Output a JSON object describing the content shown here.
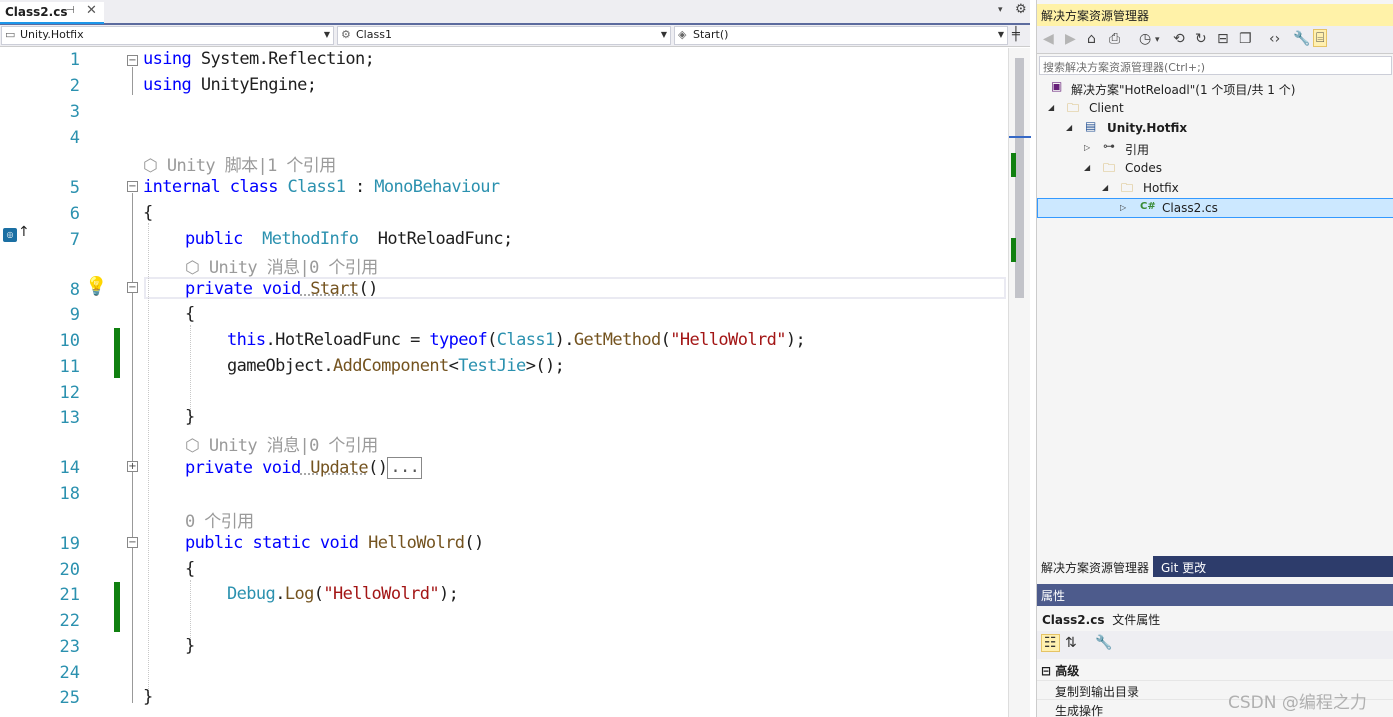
{
  "editor": {
    "tab": {
      "label": "Class2.cs",
      "pin": "⊣",
      "close": "✕"
    },
    "tab_menu_arrow": "▾",
    "settings_icon": "⚙",
    "nav": {
      "project": "Unity.Hotfix",
      "class": "Class1",
      "member": "Start()",
      "split_icon": "╪"
    },
    "line_numbers": [
      "1",
      "2",
      "3",
      "4",
      "5",
      "6",
      "7",
      "8",
      "9",
      "10",
      "11",
      "12",
      "13",
      "14",
      "18",
      "19",
      "20",
      "21",
      "22",
      "23",
      "24",
      "25"
    ],
    "lens": {
      "script": "Unity 脚本|1 个引用",
      "message1": "Unity 消息|0 个引用",
      "message2": "Unity 消息|0 个引用",
      "refs": "0 个引用"
    },
    "code": {
      "l1": {
        "kw": "using",
        "rest": " System.Reflection;"
      },
      "l2": {
        "kw": "using",
        "rest": " UnityEngine;"
      },
      "l5": {
        "kw1": "internal",
        "kw2": " class",
        "cls": " Class1",
        "colon": " : ",
        "base": "MonoBehaviour"
      },
      "l6": "{",
      "l7": {
        "kw": "public",
        "ty": "  MethodInfo",
        "rest": "  HotReloadFunc;"
      },
      "l8": {
        "kw": "private void",
        "me": " Start",
        "rest": "()"
      },
      "l9": "{",
      "l10": {
        "kw": "this",
        "rest1": ".HotReloadFunc = ",
        "kw2": "typeof",
        "p1": "(",
        "ty": "Class1",
        "p2": ").",
        "me": "GetMethod",
        "p3": "(",
        "st": "\"HelloWolrd\"",
        "p4": ");"
      },
      "l11": {
        "rest1": "gameObject.",
        "me": "AddComponent",
        "lt": "<",
        "ty": "TestJie",
        "gt": ">",
        "rest2": "();"
      },
      "l13": "}",
      "l14": {
        "kw": "private void",
        "me": " Update",
        "rest": "()",
        "collapsed": "..."
      },
      "l19": {
        "kw": "public static void",
        "me": " HelloWolrd",
        "rest": "()"
      },
      "l20": "{",
      "l21": {
        "ty": "Debug",
        "dot": ".",
        "me": "Log",
        "p1": "(",
        "st": "\"HelloWolrd\"",
        "p2": ");"
      },
      "l23": "}",
      "l25": "}"
    }
  },
  "solution_explorer": {
    "title": "解决方案资源管理器",
    "search_placeholder": "搜索解决方案资源管理器(Ctrl+;)",
    "tree": {
      "solution": "解决方案\"HotReloadl\"(1 个项目/共 1 个)",
      "client": "Client",
      "project": "Unity.Hotfix",
      "references": "引用",
      "codes": "Codes",
      "hotfix": "Hotfix",
      "file": "Class2.cs"
    },
    "bottom_tabs": [
      "解决方案资源管理器",
      "Git 更改"
    ]
  },
  "properties": {
    "title": "属性",
    "object_name": "Class2.cs",
    "object_type": "文件属性",
    "category": "高级",
    "rows": [
      "复制到输出目录",
      "生成操作"
    ]
  },
  "watermark": "CSDN @编程之力",
  "colors": {
    "keyword": "#0000ff",
    "type": "#2b91af",
    "string": "#a31515",
    "method": "#74531f",
    "changed": "#108010",
    "accent": "#1c97ea"
  }
}
